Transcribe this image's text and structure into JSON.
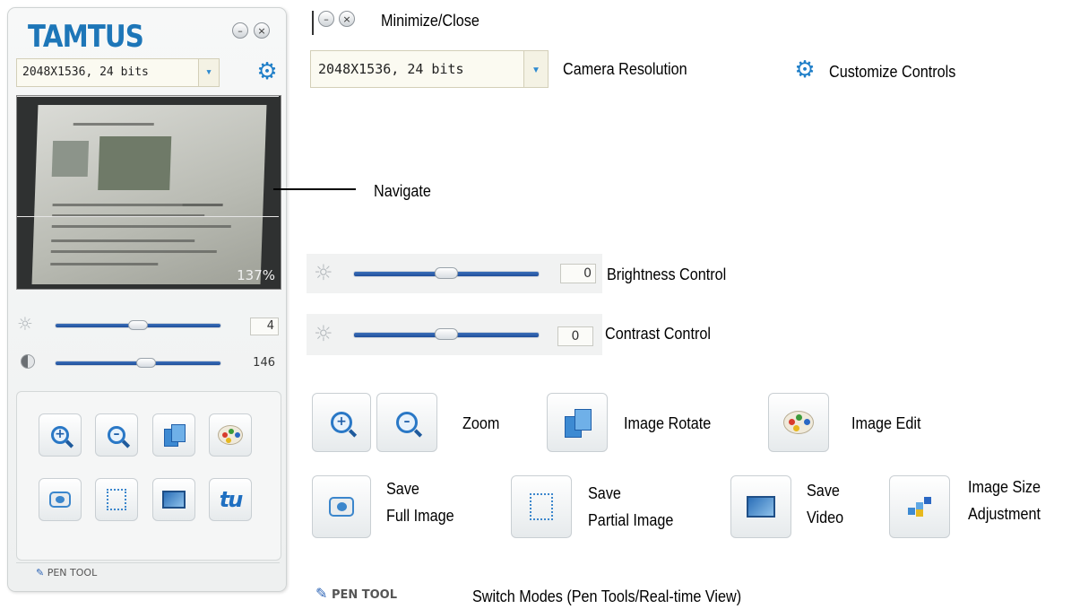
{
  "app": {
    "title": "TAMTUS",
    "resolution_value": "2048X1536, 24 bits",
    "preview_zoom": "137%",
    "brightness_value": "4",
    "contrast_value": "146",
    "pen_tool_label": "PEN TOOL",
    "window_buttons": {
      "minimize": "–",
      "close": "×"
    }
  },
  "legend": {
    "minimize_close": "Minimize/Close",
    "resolution_value": "2048X1536, 24 bits",
    "camera_resolution": "Camera Resolution",
    "customize_controls": "Customize Controls",
    "navigate": "Navigate",
    "brightness_value": "0",
    "brightness_control": "Brightness Control",
    "contrast_value": "0",
    "contrast_control": "Contrast Control",
    "zoom": "Zoom",
    "image_rotate": "Image Rotate",
    "image_edit": "Image Edit",
    "save_full_1": "Save",
    "save_full_2": "Full Image",
    "save_partial_1": "Save",
    "save_partial_2": "Partial Image",
    "save_video_1": "Save",
    "save_video_2": "Video",
    "image_size_1": "Image Size",
    "image_size_2": "Adjustment",
    "pen_tool_label": "PEN TOOL",
    "switch_modes": "Switch Modes (Pen Tools/Real-time View)"
  },
  "sliders": {
    "brightness_fraction": 0.5,
    "contrast_fraction": 0.55
  },
  "colors": {
    "accent": "#1d76b8",
    "slider_fill": "#2c5fac"
  },
  "icons": {
    "minimize": "minimize-icon",
    "close": "close-icon",
    "gear": "gear-icon",
    "zoom_in": "zoom-in-icon",
    "zoom_out": "zoom-out-icon",
    "rotate": "rotate-icon",
    "edit": "palette-icon",
    "save_full": "camera-icon",
    "save_partial": "partial-capture-icon",
    "save_video": "monitor-icon",
    "resize": "image-size-icon",
    "pen": "pen-icon",
    "brightness": "sun-icon",
    "contrast": "contrast-icon"
  }
}
